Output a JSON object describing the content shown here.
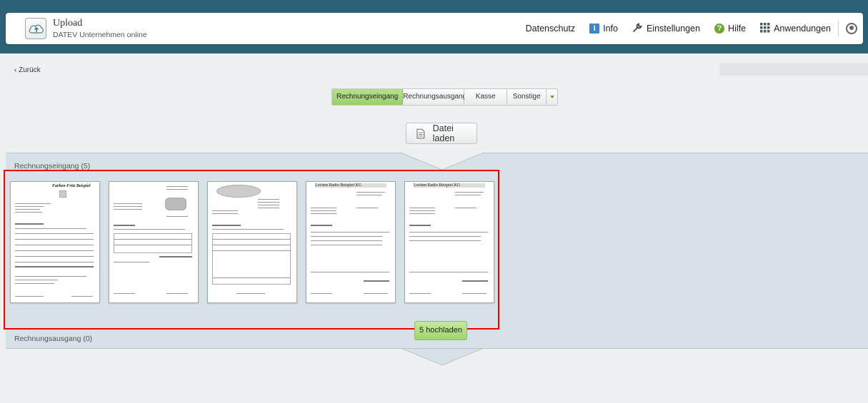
{
  "header": {
    "app_title": "Upload",
    "app_subtitle": "DATEV Unternehmen online",
    "nav": {
      "datenschutz": "Datenschutz",
      "info": "Info",
      "einstellungen": "Einstellungen",
      "hilfe": "Hilfe",
      "anwendungen": "Anwendungen"
    }
  },
  "back_label": "Zurück",
  "tabs": [
    {
      "label": "Rechnungseingang",
      "active": true
    },
    {
      "label": "Rechnungsausgang",
      "active": false
    },
    {
      "label": "Kasse",
      "active": false
    },
    {
      "label": "Sonstige",
      "active": false
    }
  ],
  "file_button_label": "Datei laden",
  "sections": {
    "eingang": "Rechnungseingang (5)",
    "ausgang": "Rechnungsausgang (0)"
  },
  "upload_button_label": "5 hochladen",
  "documents": [
    {
      "heading": "Farben-Fritz Beispiel"
    },
    {
      "heading": ""
    },
    {
      "heading": ""
    },
    {
      "heading": "Lochen Radio Beispiel KG"
    },
    {
      "heading": "Lochen Radio Beispiel KG"
    }
  ],
  "colors": {
    "header_band": "#2b6277",
    "section_bg": "#d6e2e7",
    "active_green": "#9bcf6a",
    "highlight_border": "#ee0000"
  },
  "icons": [
    "upload-cloud-icon",
    "info-icon",
    "wrench-icon",
    "help-icon",
    "apps-grid-icon",
    "user-icon",
    "file-icon",
    "chevron-left-icon",
    "chevron-down-icon"
  ]
}
